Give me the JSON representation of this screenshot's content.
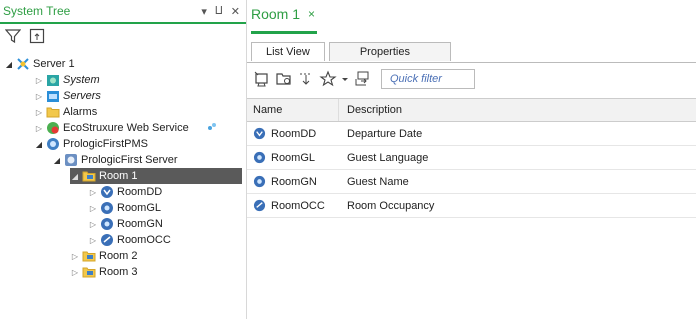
{
  "left_panel": {
    "title": "System Tree",
    "header_buttons": [
      "▾",
      "⨿",
      "✕"
    ],
    "tree": [
      {
        "label": "Server 1",
        "italic": false,
        "icon": "server-icon"
      },
      {
        "label": "System",
        "italic": true,
        "icon": "system-folder-icon"
      },
      {
        "label": "Servers",
        "italic": true,
        "icon": "servers-folder-icon"
      },
      {
        "label": "Alarms",
        "italic": false,
        "icon": "folder-icon"
      },
      {
        "label": "EcoStruxure Web Service",
        "italic": false,
        "icon": "web-service-icon"
      },
      {
        "label": "PrologicFirstPMS",
        "italic": false,
        "icon": "interface-icon"
      },
      {
        "label": "PrologicFirst Server",
        "italic": false,
        "icon": "device-icon"
      },
      {
        "label": "Room 1",
        "italic": false,
        "icon": "room-folder-icon"
      },
      {
        "label": "RoomDD",
        "italic": false,
        "icon": "value-icon"
      },
      {
        "label": "RoomGL",
        "italic": false,
        "icon": "value-icon"
      },
      {
        "label": "RoomGN",
        "italic": false,
        "icon": "value-icon"
      },
      {
        "label": "RoomOCC",
        "italic": false,
        "icon": "value-icon"
      },
      {
        "label": "Room 2",
        "italic": false,
        "icon": "room-folder-icon"
      },
      {
        "label": "Room 3",
        "italic": false,
        "icon": "room-folder-icon"
      }
    ]
  },
  "document": {
    "tab_title": "Room 1",
    "tab_close": "×",
    "subtabs": [
      "List View",
      "Properties"
    ],
    "quick_filter_placeholder": "Quick filter",
    "columns": [
      "Name",
      "Description"
    ],
    "rows": [
      {
        "name": "RoomDD",
        "description": "Departure Date"
      },
      {
        "name": "RoomGL",
        "description": "Guest Language"
      },
      {
        "name": "RoomGN",
        "description": "Guest Name"
      },
      {
        "name": "RoomOCC",
        "description": "Room Occupancy"
      }
    ]
  },
  "colors": {
    "accent": "#22a34a",
    "selection": "#5a5a5a",
    "link_blue": "#4a6fb5"
  }
}
